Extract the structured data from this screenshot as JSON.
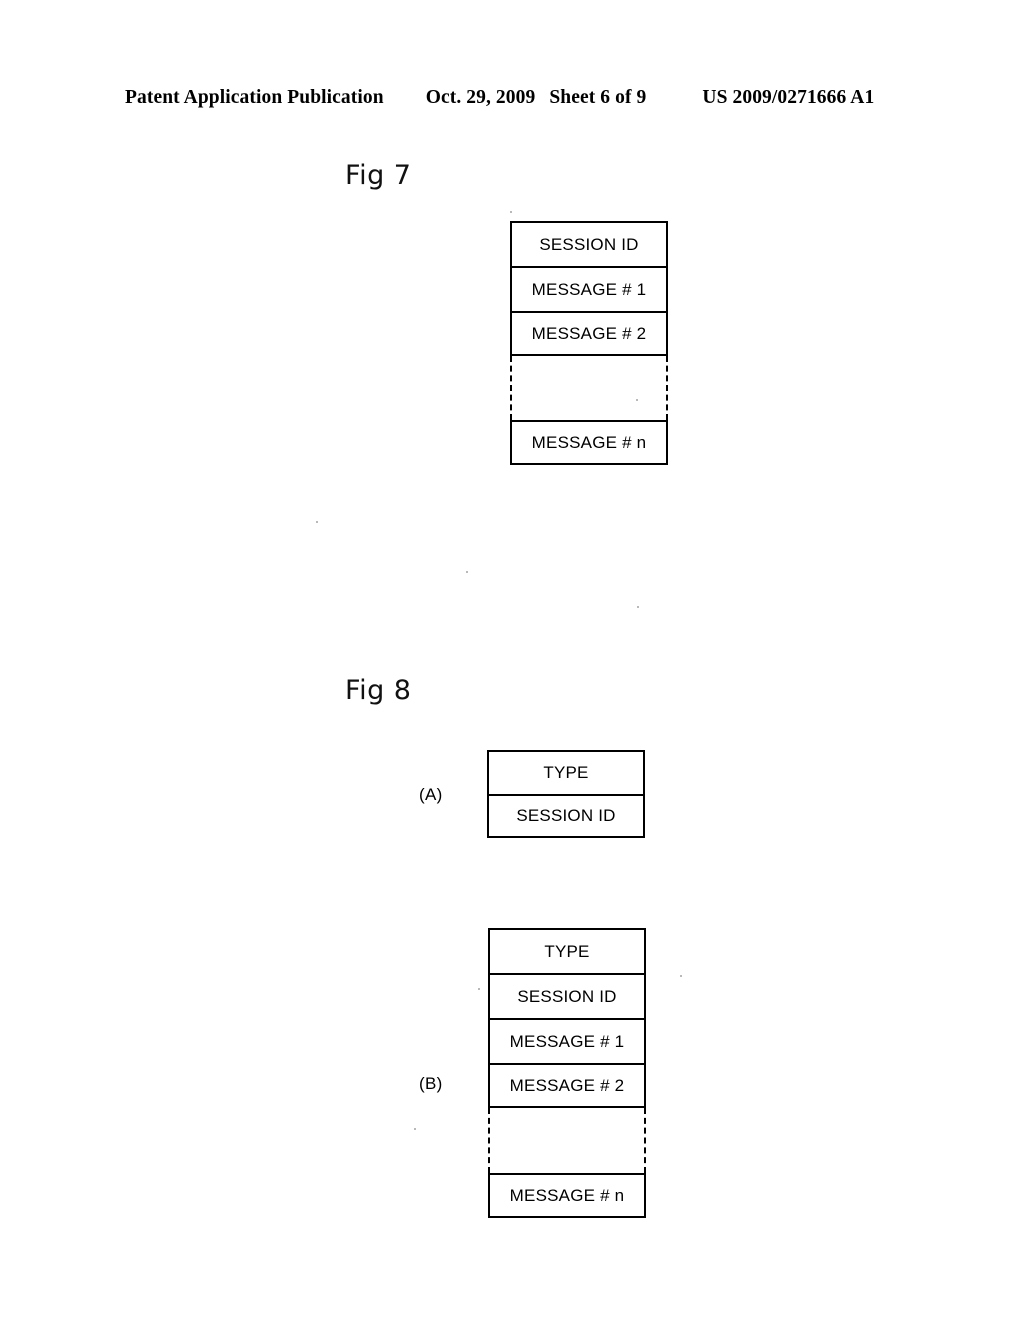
{
  "header": {
    "publication": "Patent Application Publication",
    "date": "Oct. 29, 2009",
    "sheet": "Sheet 6 of 9",
    "patent_number": "US 2009/0271666 A1"
  },
  "figures": [
    {
      "title": "Fig 7",
      "table": {
        "rows": [
          "SESSION ID",
          "MESSAGE # 1",
          "MESSAGE # 2"
        ],
        "gap": "",
        "tail_row": "MESSAGE # n"
      }
    },
    {
      "title": "Fig 8",
      "parts": [
        {
          "label": "(A)",
          "rows": [
            "TYPE",
            "SESSION ID"
          ]
        },
        {
          "label": "(B)",
          "rows": [
            "TYPE",
            "SESSION ID",
            "MESSAGE # 1",
            "MESSAGE # 2"
          ],
          "gap": "",
          "tail_row": "MESSAGE # n"
        }
      ]
    }
  ],
  "colors": {
    "ink": "#000000",
    "page": "#ffffff"
  }
}
